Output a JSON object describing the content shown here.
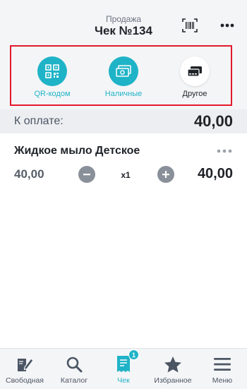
{
  "header": {
    "subtitle": "Продажа",
    "title": "Чек №134",
    "barcode_icon": "barcode-scan-icon",
    "more_icon": "more-horizontal-icon"
  },
  "payment_methods": [
    {
      "label": "QR-кодом",
      "icon": "qr-code-icon",
      "style": "teal"
    },
    {
      "label": "Наличные",
      "icon": "cash-icon",
      "style": "teal"
    },
    {
      "label": "Другое",
      "icon": "other-payment-icon",
      "style": "white"
    }
  ],
  "amount_due": {
    "label": "К оплате:",
    "value": "40,00"
  },
  "cart_items": [
    {
      "name": "Жидкое мыло Детское",
      "price": "40,00",
      "quantity": "x1",
      "total": "40,00"
    }
  ],
  "tabbar": {
    "items": [
      {
        "label": "Свободная",
        "icon": "free-sale-pencil-icon"
      },
      {
        "label": "Каталог",
        "icon": "search-icon"
      },
      {
        "label": "Чек",
        "icon": "receipt-icon",
        "badge": "1",
        "active": true
      },
      {
        "label": "Избранное",
        "icon": "star-icon"
      },
      {
        "label": "Меню",
        "icon": "menu-icon"
      }
    ]
  },
  "colors": {
    "accent": "#1fb3c7",
    "highlight_border": "#e3192c",
    "text_primary": "#1f2328",
    "panel_bg": "#f4f5f7"
  }
}
